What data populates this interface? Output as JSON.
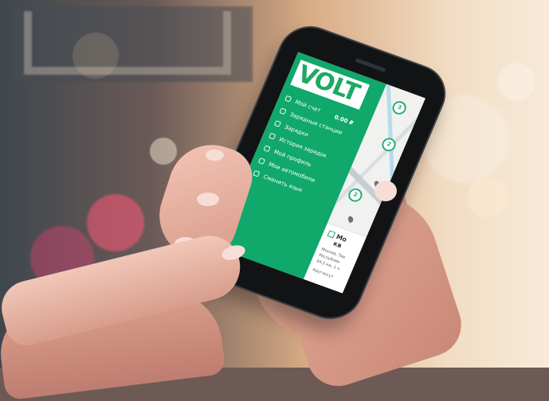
{
  "logo_text": "VOLT",
  "menu": {
    "account": "Мой счет",
    "balance": "0.00 ₽",
    "stations": "Зарядные станции",
    "charges": "Зарядки",
    "history": "История зарядок",
    "profile": "Мой профиль",
    "cars": "Мои автомобили",
    "language": "Сменить язык"
  },
  "map_markers": [
    "3",
    "2",
    "2"
  ],
  "card": {
    "title": "Мо",
    "title2": "кв",
    "line1": "Москва, Тве",
    "line2": "Республик",
    "line3": "44,5 км, 1 ч",
    "line4": "Круглосут"
  }
}
